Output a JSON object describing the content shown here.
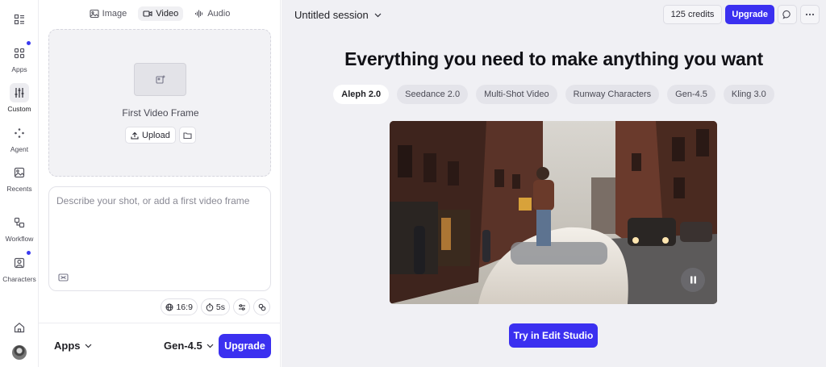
{
  "rail": {
    "items": [
      {
        "label": "Apps",
        "icon": "grid-icon",
        "badge": true
      },
      {
        "label": "Custom",
        "icon": "sliders-icon",
        "active": true
      },
      {
        "label": "Agent",
        "icon": "sparkle-icon"
      },
      {
        "label": "Recents",
        "icon": "gallery-icon"
      },
      {
        "label": "Workflow",
        "icon": "workflow-icon"
      },
      {
        "label": "Characters",
        "icon": "character-icon",
        "badge": true
      }
    ]
  },
  "panel": {
    "tabs": [
      {
        "label": "Image",
        "icon": "image-icon"
      },
      {
        "label": "Video",
        "icon": "video-icon",
        "active": true
      },
      {
        "label": "Audio",
        "icon": "audio-wave-icon"
      }
    ],
    "frame": {
      "label": "First Video Frame",
      "upload_label": "Upload"
    },
    "prompt": {
      "placeholder": "Describe your shot, or add a first video frame"
    },
    "settings": {
      "aspect_ratio": "16:9",
      "duration": "5s"
    },
    "footer": {
      "apps_label": "Apps",
      "model_label": "Gen-4.5",
      "upgrade_label": "Upgrade"
    }
  },
  "main": {
    "session_title": "Untitled session",
    "credits": "125 credits",
    "upgrade_label": "Upgrade",
    "headline": "Everything you need to make anything you want",
    "models": [
      "Aleph 2.0",
      "Seedance 2.0",
      "Multi-Shot Video",
      "Runway Characters",
      "Gen-4.5",
      "Kling 3.0"
    ],
    "active_model": "Aleph 2.0",
    "cta_label": "Try in Edit Studio"
  },
  "colors": {
    "accent": "#3b30f0",
    "main_bg": "#f0f0f4"
  }
}
